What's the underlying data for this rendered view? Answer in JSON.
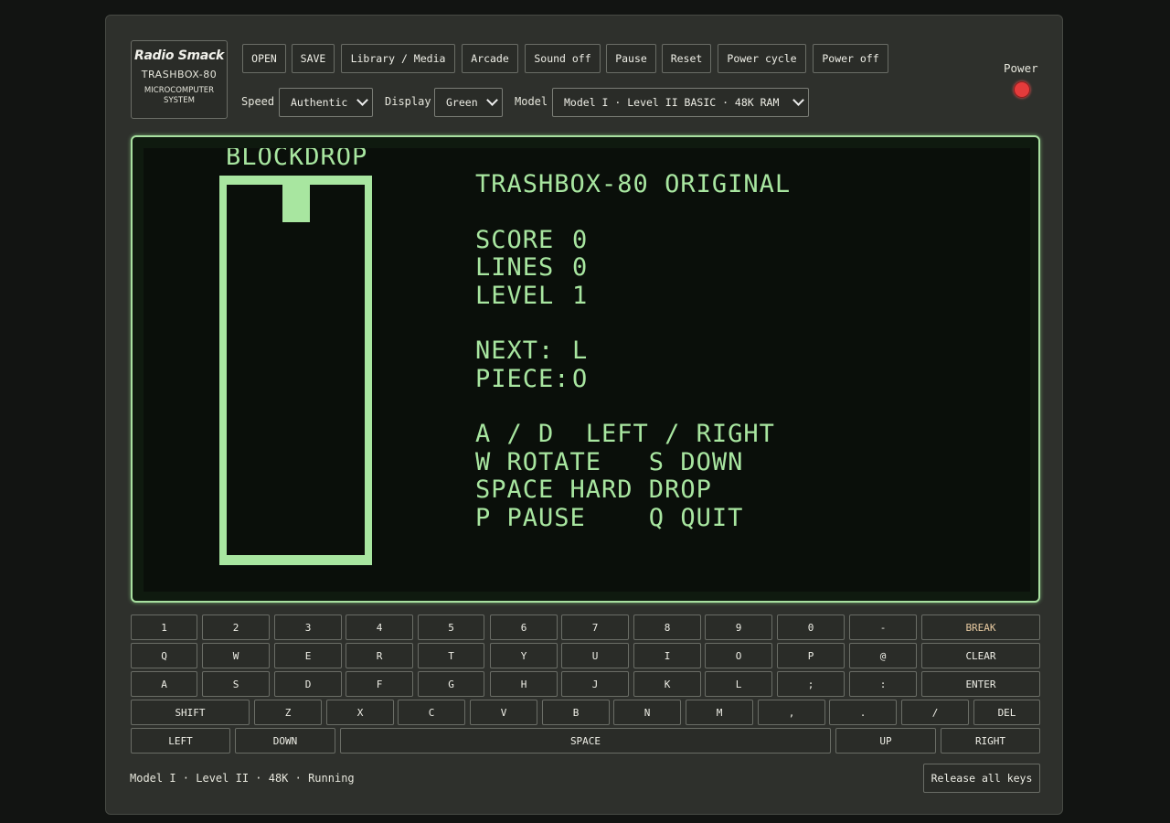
{
  "logo": {
    "brand": "Radio Smack",
    "model": "TRASHBOX-80",
    "sub1": "MICROCOMPUTER",
    "sub2": "SYSTEM"
  },
  "toolbar": {
    "open": "OPEN",
    "save": "SAVE",
    "library": "Library / Media",
    "arcade": "Arcade",
    "sound": "Sound off",
    "pause": "Pause",
    "reset": "Reset",
    "power_cycle": "Power cycle",
    "power_off": "Power off"
  },
  "settings": {
    "speed_label": "Speed",
    "speed_value": "Authentic",
    "display_label": "Display",
    "display_value": "Green",
    "model_label": "Model",
    "model_value": "Model I · Level II BASIC · 48K RAM"
  },
  "power": {
    "label": "Power",
    "led_color": "#e53b3b"
  },
  "screen": {
    "phosphor_color": "#a8e6a0",
    "game_title": "BLOCKDROP",
    "header": "TRASHBOX-80 ORIGINAL",
    "score_label": "SCORE",
    "score": "0",
    "lines_label": "LINES",
    "lines": "0",
    "level_label": "LEVEL",
    "level": "1",
    "next_label": "NEXT:",
    "next": "L",
    "piece_label": "PIECE:",
    "piece": "O",
    "help1": "A / D  LEFT / RIGHT",
    "help2": "W ROTATE   S DOWN",
    "help3": "SPACE HARD DROP",
    "help4": "P PAUSE    Q QUIT"
  },
  "keyboard": {
    "row1": [
      "1",
      "2",
      "3",
      "4",
      "5",
      "6",
      "7",
      "8",
      "9",
      "0",
      "-",
      "BREAK"
    ],
    "row2": [
      "Q",
      "W",
      "E",
      "R",
      "T",
      "Y",
      "U",
      "I",
      "O",
      "P",
      "@",
      "CLEAR"
    ],
    "row3": [
      "A",
      "S",
      "D",
      "F",
      "G",
      "H",
      "J",
      "K",
      "L",
      ";",
      ":",
      "ENTER"
    ],
    "row4": [
      "SHIFT",
      "Z",
      "X",
      "C",
      "V",
      "B",
      "N",
      "M",
      ",",
      ".",
      "/",
      "DEL"
    ],
    "row5": [
      "LEFT",
      "DOWN",
      "SPACE",
      "UP",
      "RIGHT"
    ]
  },
  "status": {
    "text": "Model I · Level II · 48K · Running",
    "release": "Release all keys"
  }
}
